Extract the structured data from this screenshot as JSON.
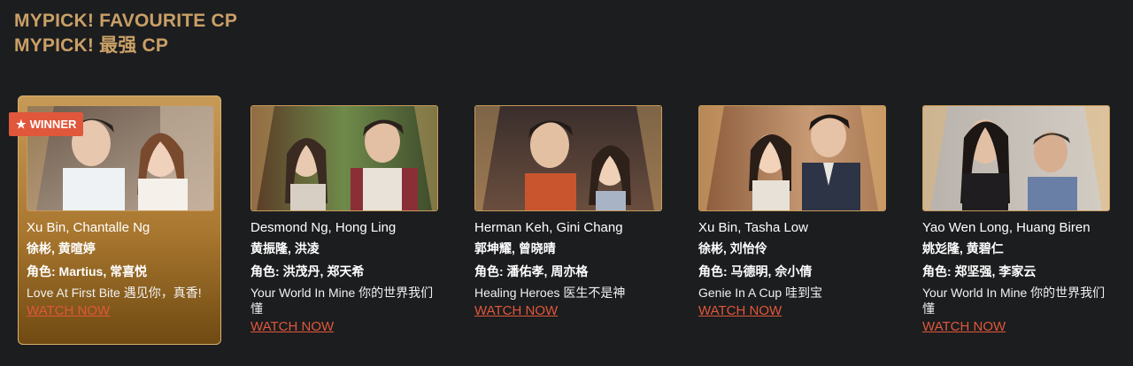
{
  "headings": {
    "line1": "MYPICK! FAVOURITE CP",
    "line2": "MYPICK! 最强 CP"
  },
  "badge": {
    "label": "WINNER",
    "icon": "star-icon"
  },
  "colors": {
    "background": "#1c1d1f",
    "heading": "#c9a066",
    "accent": "#e0573b",
    "winner_card": "#b5843d",
    "thumb_border": "#c89a5a"
  },
  "cards": [
    {
      "names": "Xu Bin, Chantalle Ng",
      "chinese_names": "徐彬, 黄暄婷",
      "role": "角色: Martius, 常喜悦",
      "show": "Love At First Bite 遇见你，真香!",
      "watch": "WATCH NOW",
      "winner": true
    },
    {
      "names": "Desmond Ng, Hong Ling",
      "chinese_names": "黄振隆, 洪凌",
      "role": "角色: 洪茂丹, 郑天希",
      "show": "Your World In Mine 你的世界我们懂",
      "watch": "WATCH NOW",
      "winner": false
    },
    {
      "names": "Herman Keh, Gini Chang",
      "chinese_names": "郭坤耀, 曾晓晴",
      "role": "角色: 潘佑孝, 周亦格",
      "show": "Healing Heroes 医生不是神",
      "watch": "WATCH NOW",
      "winner": false
    },
    {
      "names": "Xu Bin, Tasha Low",
      "chinese_names": "徐彬, 刘怡伶",
      "role": "角色: 马德明, 佘小倩",
      "show": "Genie In A Cup 哇到宝",
      "watch": "WATCH NOW",
      "winner": false
    },
    {
      "names": "Yao Wen Long, Huang Biren",
      "chinese_names": "姚彣隆, 黄碧仁",
      "role": "角色: 郑坚强, 李家云",
      "show": "Your World In Mine 你的世界我们懂",
      "watch": "WATCH NOW",
      "winner": false
    }
  ]
}
